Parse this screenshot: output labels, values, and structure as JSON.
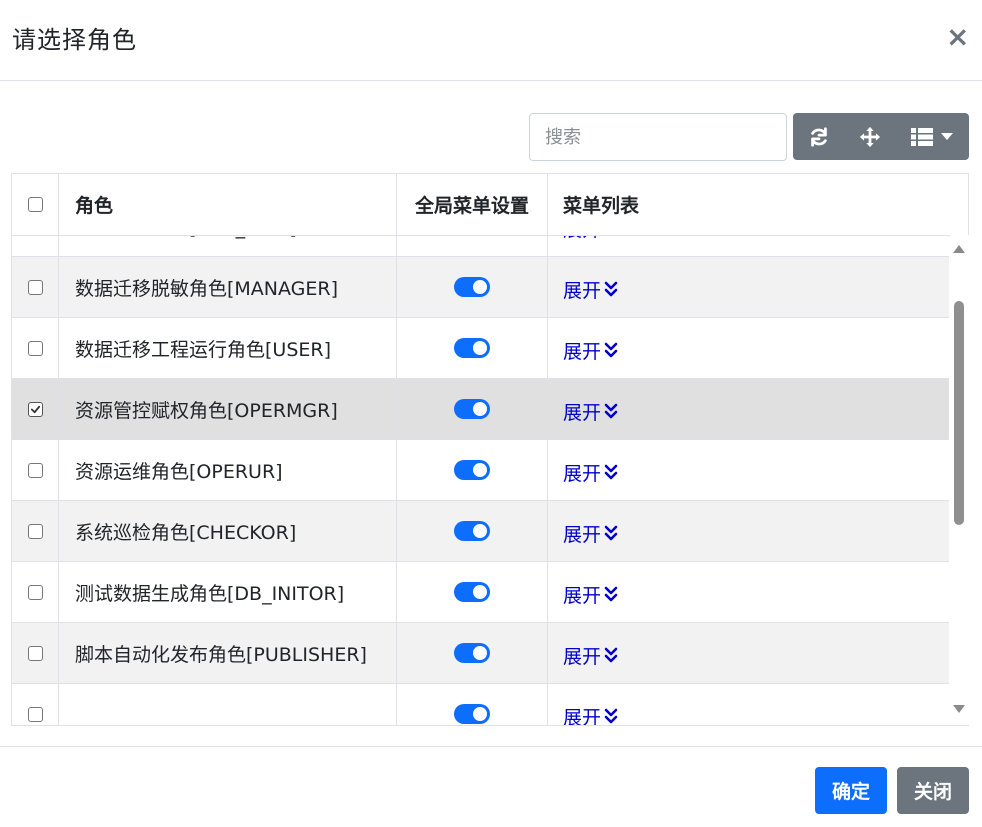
{
  "modal": {
    "title": "请选择角色",
    "close_label": "×"
  },
  "toolbar": {
    "search_placeholder": "搜索",
    "buttons": [
      {
        "name": "refresh",
        "icon": "refresh-icon"
      },
      {
        "name": "move",
        "icon": "move-arrows-icon"
      },
      {
        "name": "columns",
        "icon": "list-columns-icon"
      }
    ]
  },
  "table": {
    "headers": [
      "",
      "角色",
      "全局菜单设置",
      "菜单列表"
    ],
    "expand_label": "展开",
    "rows": [
      {
        "role": "用户赋权角色[USR_MGR]",
        "checked": false,
        "global_menu": true
      },
      {
        "role": "数据迁移脱敏角色[MANAGER]",
        "checked": false,
        "global_menu": true
      },
      {
        "role": "数据迁移工程运行角色[USER]",
        "checked": false,
        "global_menu": true
      },
      {
        "role": "资源管控赋权角色[OPERMGR]",
        "checked": true,
        "global_menu": true
      },
      {
        "role": "资源运维角色[OPERUR]",
        "checked": false,
        "global_menu": true
      },
      {
        "role": "系统巡检角色[CHECKOR]",
        "checked": false,
        "global_menu": true
      },
      {
        "role": "测试数据生成角色[DB_INITOR]",
        "checked": false,
        "global_menu": true
      },
      {
        "role": "脚本自动化发布角色[PUBLISHER]",
        "checked": false,
        "global_menu": true
      },
      {
        "role": "",
        "checked": false,
        "global_menu": true
      }
    ]
  },
  "footer": {
    "confirm_label": "确定",
    "close_label": "关闭"
  },
  "colors": {
    "primary": "#0d6efd",
    "secondary": "#6c757d",
    "link": "#0000cc",
    "selected_row": "#e0e0e0",
    "striped_row": "#f2f2f2"
  }
}
